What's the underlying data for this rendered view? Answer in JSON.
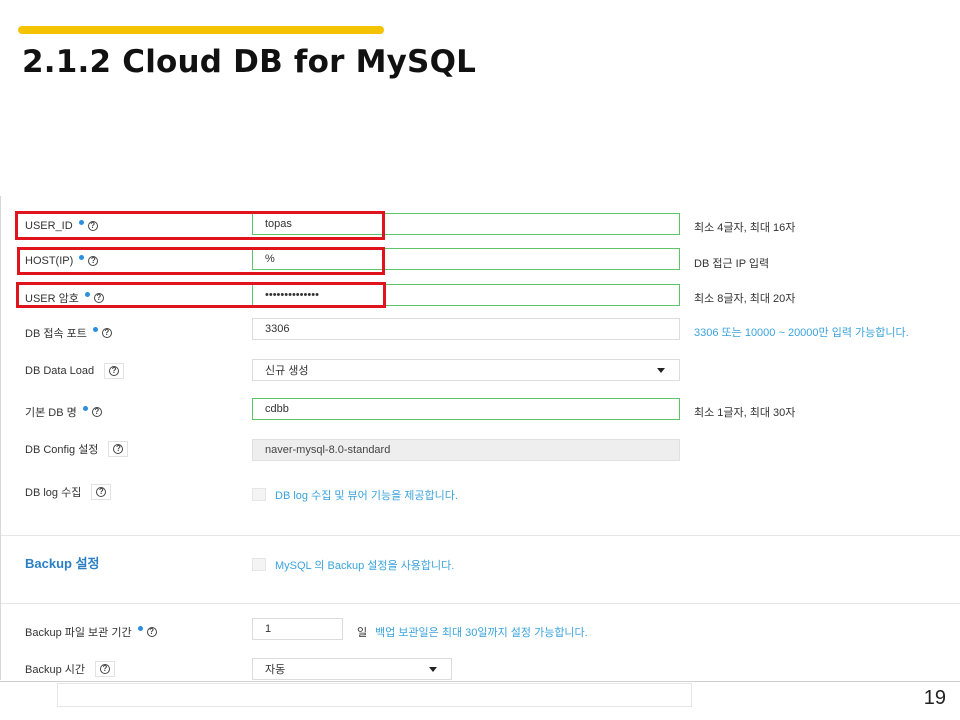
{
  "slide": {
    "title": "2.1.2 Cloud DB for MySQL",
    "page_number": "19",
    "accent_color": "#f5c200"
  },
  "form": {
    "user_id": {
      "label": "USER_ID",
      "value": "topas",
      "hint": "최소 4글자, 최대 16자"
    },
    "host": {
      "label": "HOST(IP)",
      "value": "%",
      "hint": "DB 접근 IP 입력"
    },
    "password": {
      "label": "USER 암호",
      "value": "••••••••••••••",
      "hint": "최소 8글자, 최대 20자"
    },
    "port": {
      "label": "DB 접속 포트",
      "value": "3306",
      "hint": "3306 또는 10000 ~ 20000만 입력 가능합니다."
    },
    "data_load": {
      "label": "DB Data Load",
      "value": "신규 생성"
    },
    "db_name": {
      "label": "기본 DB 명",
      "value": "cdbb",
      "hint": "최소 1글자, 최대 30자"
    },
    "db_config": {
      "label": "DB Config 설정",
      "value": "naver-mysql-8.0-standard"
    },
    "db_log": {
      "label": "DB log 수집",
      "checkbox_label": "DB log 수집 및 뷰어 기능을 제공합니다."
    },
    "backup_section": {
      "title": "Backup 설정",
      "checkbox_label": "MySQL 의 Backup 설정을 사용합니다."
    },
    "backup_retention": {
      "label": "Backup 파일 보관 기간",
      "value": "1",
      "unit": "일",
      "hint": "백업 보관일은 최대 30일까지 설정 가능합니다."
    },
    "backup_time": {
      "label": "Backup 시간",
      "value": "자동"
    }
  },
  "colors": {
    "highlight_red": "#e0141d",
    "valid_green": "#5ec46a",
    "hint_blue": "#3aa3db",
    "required_dot": "#2b8fe0"
  },
  "icons": {
    "help": "question-circle-icon",
    "dropdown": "caret-down-icon"
  }
}
